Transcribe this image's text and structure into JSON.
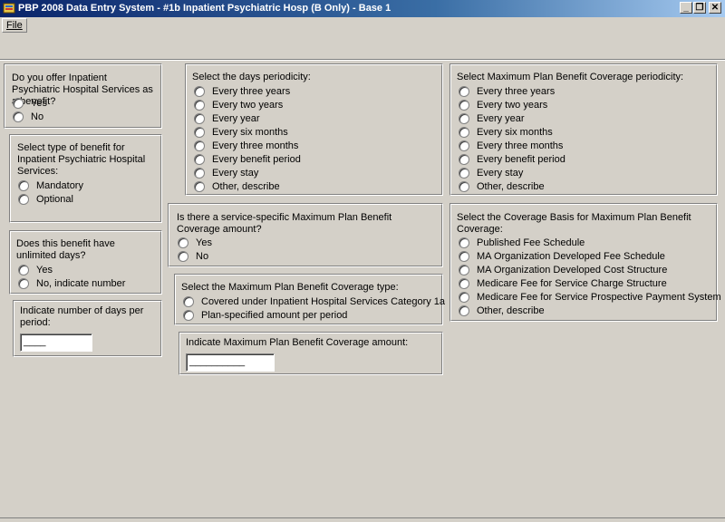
{
  "window": {
    "title": "PBP 2008 Data Entry System - #1b Inpatient Psychiatric Hosp (B Only) - Base 1",
    "minimize": "_",
    "restore": "❐",
    "close": "✕"
  },
  "menu": {
    "file": "File"
  },
  "offer": {
    "question": "Do you offer Inpatient Psychiatric Hospital Services as a benefit?",
    "options": [
      "Yes",
      "No"
    ]
  },
  "benefit_type": {
    "question": "Select type of benefit for Inpatient Psychiatric Hospital Services:",
    "options": [
      "Mandatory",
      "Optional"
    ]
  },
  "unlimited": {
    "question": "Does this benefit have unlimited days?",
    "options": [
      "Yes",
      "No, indicate number"
    ]
  },
  "num_days": {
    "question": "Indicate number of days per period:",
    "value": "____"
  },
  "days_periodicity": {
    "question": "Select the days periodicity:",
    "options": [
      "Every three years",
      "Every two years",
      "Every year",
      "Every six months",
      "Every three months",
      "Every benefit period",
      "Every stay",
      "Other, describe"
    ]
  },
  "service_max": {
    "question": "Is there a service-specific Maximum Plan Benefit Coverage amount?",
    "options": [
      "Yes",
      "No"
    ]
  },
  "max_type": {
    "question": "Select the Maximum Plan Benefit Coverage type:",
    "options": [
      "Covered under Inpatient Hospital Services Category 1a",
      "Plan-specified amount per period"
    ]
  },
  "max_amount": {
    "question": "Indicate Maximum Plan Benefit Coverage amount:",
    "value": "__________"
  },
  "max_periodicity": {
    "question": "Select Maximum Plan Benefit Coverage periodicity:",
    "options": [
      "Every three years",
      "Every two years",
      "Every year",
      "Every six months",
      "Every three months",
      "Every benefit period",
      "Every stay",
      "Other, describe"
    ]
  },
  "coverage_basis": {
    "question": "Select the Coverage Basis for Maximum Plan Benefit Coverage:",
    "options": [
      "Published Fee Schedule",
      "MA Organization Developed Fee Schedule",
      "MA Organization Developed Cost Structure",
      "Medicare Fee for Service Charge Structure",
      "Medicare Fee for Service Prospective Payment System",
      "Other, describe"
    ]
  }
}
